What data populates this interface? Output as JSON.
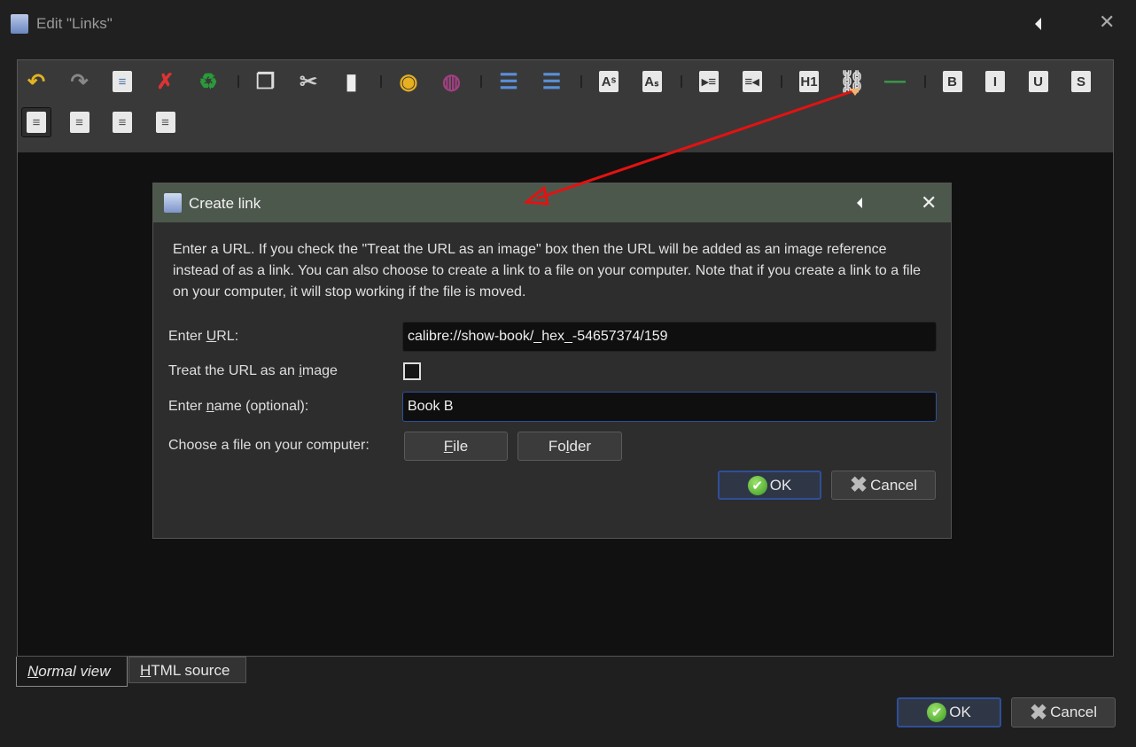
{
  "window": {
    "title": "Edit \"Links\""
  },
  "toolbar": {
    "row1": [
      {
        "name": "undo",
        "glyph": "↶",
        "style": "plain",
        "color": "#e3b321"
      },
      {
        "name": "redo",
        "glyph": "↷",
        "style": "plain",
        "color": "#888"
      },
      {
        "name": "select-all",
        "glyph": "≡",
        "style": "box",
        "color": "#5577aa"
      },
      {
        "name": "remove-formatting",
        "glyph": "✗",
        "style": "plain",
        "color": "#d33"
      },
      {
        "name": "recycle",
        "glyph": "♻",
        "style": "plain",
        "color": "#2a9a3a"
      },
      {
        "sep": true
      },
      {
        "name": "copy",
        "glyph": "❐",
        "style": "plain",
        "color": "#ddd"
      },
      {
        "name": "cut",
        "glyph": "✂",
        "style": "plain",
        "color": "#ccc"
      },
      {
        "name": "paste",
        "glyph": "▮",
        "style": "plain",
        "color": "#eee"
      },
      {
        "sep": true
      },
      {
        "name": "background-color",
        "glyph": "◉",
        "style": "plain",
        "color": "#e6b020"
      },
      {
        "name": "text-color",
        "glyph": "◍",
        "style": "plain",
        "color": "#a04080"
      },
      {
        "sep": true
      },
      {
        "name": "numbered-list",
        "glyph": "☰",
        "style": "plain",
        "color": "#5b8fd8"
      },
      {
        "name": "bullet-list",
        "glyph": "☰",
        "style": "plain",
        "color": "#5b8fd8"
      },
      {
        "sep": true
      },
      {
        "name": "superscript",
        "glyph": "Aˢ",
        "style": "box",
        "color": "#333"
      },
      {
        "name": "subscript",
        "glyph": "Aₛ",
        "style": "box",
        "color": "#333"
      },
      {
        "sep": true
      },
      {
        "name": "indent",
        "glyph": "▸≡",
        "style": "box",
        "color": "#333"
      },
      {
        "name": "outdent",
        "glyph": "≡◂",
        "style": "box",
        "color": "#333"
      },
      {
        "sep": true
      },
      {
        "name": "heading",
        "glyph": "H1",
        "style": "box",
        "color": "#333"
      },
      {
        "name": "insert-link",
        "glyph": "⛓",
        "style": "plain",
        "color": "#ddd"
      },
      {
        "name": "horizontal-rule",
        "glyph": "—",
        "style": "plain",
        "color": "#3a9a4a"
      },
      {
        "sep": true
      },
      {
        "name": "bold",
        "glyph": "B",
        "style": "box",
        "color": "#333"
      },
      {
        "name": "italic",
        "glyph": "I",
        "style": "box",
        "color": "#333"
      },
      {
        "name": "underline",
        "glyph": "U",
        "style": "box",
        "color": "#333"
      },
      {
        "name": "strikethrough",
        "glyph": "S",
        "style": "box",
        "color": "#333"
      }
    ],
    "row2": [
      {
        "name": "align-left",
        "glyph": "≡",
        "style": "box",
        "color": "#555",
        "active": true
      },
      {
        "name": "align-center",
        "glyph": "≡",
        "style": "box",
        "color": "#555"
      },
      {
        "name": "align-right",
        "glyph": "≡",
        "style": "box",
        "color": "#555"
      },
      {
        "name": "justify",
        "glyph": "≡",
        "style": "box",
        "color": "#555"
      }
    ]
  },
  "dialog": {
    "title": "Create link",
    "description": "Enter a URL. If you check the \"Treat the URL as an image\" box then the URL will be added as an image reference instead of as a link. You can also choose to create a link to a file on your computer. Note that if you create a link to a file on your computer, it will stop working if the file is moved.",
    "url_label_pre": "Enter ",
    "url_label_u": "U",
    "url_label_post": "RL:",
    "url_value": "calibre://show-book/_hex_-54657374/159",
    "image_label_pre": "Treat the URL as an ",
    "image_label_u": "i",
    "image_label_post": "mage",
    "image_checked": false,
    "name_label_pre": "Enter ",
    "name_label_u": "n",
    "name_label_post": "ame (optional):",
    "name_value": "Book B",
    "file_label": "Choose a file on your computer:",
    "file_u": "F",
    "file_rest": "ile",
    "folder_pre": "Fo",
    "folder_u": "l",
    "folder_post": "der",
    "ok": "OK",
    "cancel": "Cancel"
  },
  "tabs": {
    "normal_u": "N",
    "normal_rest": "ormal view",
    "html_u": "H",
    "html_rest": "TML source"
  },
  "footer": {
    "ok": "OK",
    "cancel": "Cancel"
  },
  "annotation_color": "#e31212"
}
